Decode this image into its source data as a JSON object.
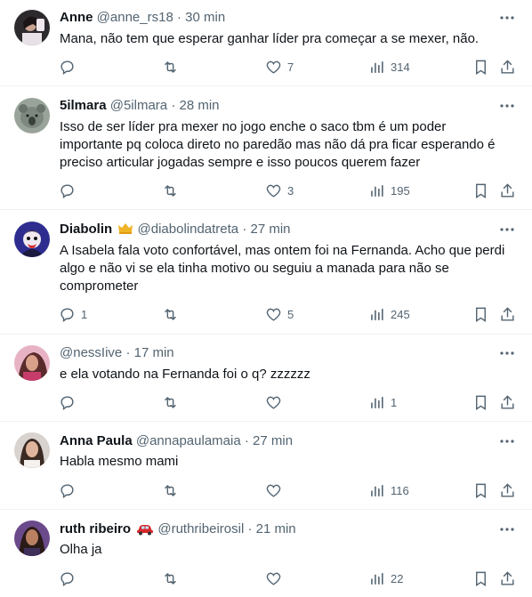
{
  "tweets": [
    {
      "name": "Anne",
      "handle": "@anne_rs18",
      "time": "30 min",
      "text": "Mana, não tem que esperar ganhar líder pra começar a se mexer, não.",
      "replies": "",
      "retweets": "",
      "likes": "7",
      "views": "314",
      "badge": ""
    },
    {
      "name": "5ilmara",
      "handle": "@5ilmara",
      "time": "28 min",
      "text": "Isso de ser líder pra mexer no jogo enche o saco tbm é um poder\nimportante pq coloca direto no paredão mas não dá pra ficar esperando é\npreciso articular jogadas sempre e isso poucos querem fazer",
      "replies": "",
      "retweets": "",
      "likes": "3",
      "views": "195",
      "badge": ""
    },
    {
      "name": "Diabolin",
      "handle": "@diabolindatreta",
      "time": "27 min",
      "text": "A Isabela fala voto confortável, mas ontem foi na Fernanda. Acho que perdi\nalgo e não vi se ela tinha motivo ou seguiu a manada para não se\ncomprometer",
      "replies": "1",
      "retweets": "",
      "likes": "5",
      "views": "245",
      "badge": "crown-icon"
    },
    {
      "name": "",
      "handle": "@nessIive",
      "time": "17 min",
      "text": "e ela votando na Fernanda foi o q? zzzzzz",
      "replies": "",
      "retweets": "",
      "likes": "",
      "views": "1",
      "badge": ""
    },
    {
      "name": "Anna Paula",
      "handle": "@annapaulamaia",
      "time": "27 min",
      "text": "Habla mesmo mami",
      "replies": "",
      "retweets": "",
      "likes": "",
      "views": "116",
      "badge": ""
    },
    {
      "name": "ruth ribeiro",
      "handle": "@ruthribeirosil",
      "time": "21 min",
      "text": "Olha ja",
      "replies": "",
      "retweets": "",
      "likes": "",
      "views": "22",
      "badge": "car-emoji"
    }
  ],
  "separator": "·",
  "colors": {
    "text": "#0f1419",
    "secondary": "#536471",
    "border": "#eff3f4"
  }
}
